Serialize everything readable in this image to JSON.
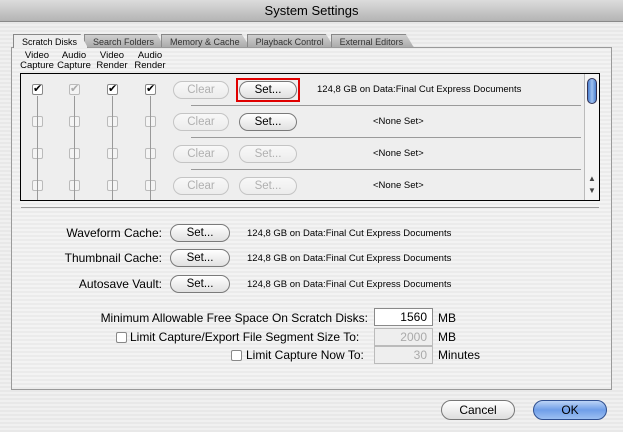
{
  "window": {
    "title": "System Settings"
  },
  "tabs": [
    {
      "label": "Scratch Disks",
      "active": true
    },
    {
      "label": "Search Folders",
      "active": false
    },
    {
      "label": "Memory & Cache",
      "active": false
    },
    {
      "label": "Playback Control",
      "active": false
    },
    {
      "label": "External Editors",
      "active": false
    }
  ],
  "columns": [
    {
      "line1": "Video",
      "line2": "Capture"
    },
    {
      "line1": "Audio",
      "line2": "Capture"
    },
    {
      "line1": "Video",
      "line2": "Render"
    },
    {
      "line1": "Audio",
      "line2": "Render"
    }
  ],
  "scratch_rows": [
    {
      "checks": [
        true,
        true,
        true,
        true
      ],
      "enabled": [
        true,
        false,
        true,
        true
      ],
      "clear_label": "Clear",
      "set_label": "Set...",
      "set_enabled": true,
      "info": "124,8 GB on  Data:Final Cut Express Documents"
    },
    {
      "checks": [
        false,
        false,
        false,
        false
      ],
      "enabled": [
        false,
        false,
        false,
        false
      ],
      "clear_label": "Clear",
      "set_label": "Set...",
      "set_enabled": true,
      "info": "<None Set>"
    },
    {
      "checks": [
        false,
        false,
        false,
        false
      ],
      "enabled": [
        false,
        false,
        false,
        false
      ],
      "clear_label": "Clear",
      "set_label": "Set...",
      "set_enabled": false,
      "info": "<None Set>"
    },
    {
      "checks": [
        false,
        false,
        false,
        false
      ],
      "enabled": [
        false,
        false,
        false,
        false
      ],
      "clear_label": "Clear",
      "set_label": "Set...",
      "set_enabled": false,
      "info": "<None Set>"
    }
  ],
  "caches": [
    {
      "label": "Waveform Cache:",
      "set_label": "Set...",
      "info": "124,8 GB on  Data:Final Cut Express Documents"
    },
    {
      "label": "Thumbnail Cache:",
      "set_label": "Set...",
      "info": "124,8 GB on  Data:Final Cut Express Documents"
    },
    {
      "label": "Autosave Vault:",
      "set_label": "Set...",
      "info": "124,8 GB on  Data:Final Cut Express Documents"
    }
  ],
  "options": {
    "min_free": {
      "label": "Minimum Allowable Free Space On Scratch Disks:",
      "value": "1560",
      "unit": "MB"
    },
    "limit_segment": {
      "label": "Limit Capture/Export File Segment Size To:",
      "value": "2000",
      "unit": "MB",
      "checked": false
    },
    "limit_capture": {
      "label": "Limit Capture Now To:",
      "value": "30",
      "unit": "Minutes",
      "checked": false
    }
  },
  "buttons": {
    "cancel": "Cancel",
    "ok": "OK"
  },
  "glyphs": {
    "check": "✔",
    "up_arrow": "▲",
    "down_arrow": "▼"
  }
}
